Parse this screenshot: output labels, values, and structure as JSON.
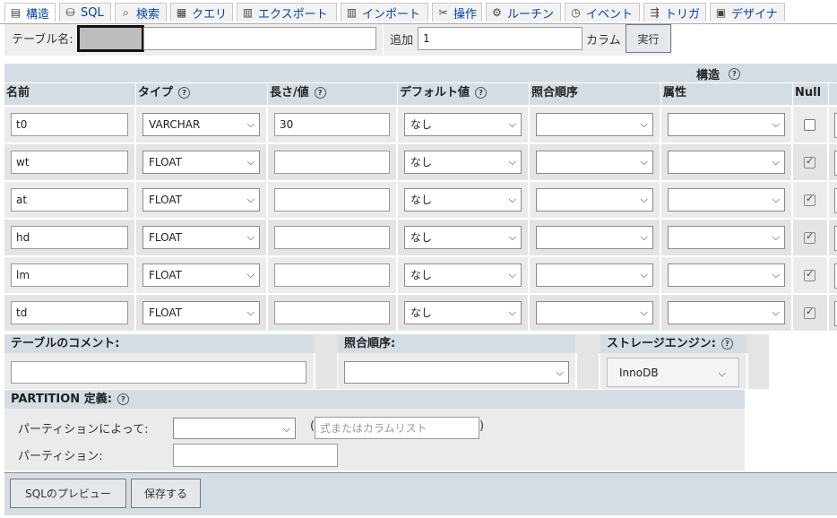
{
  "tabs": [
    {
      "label": "構造",
      "icon": "structure-icon",
      "glyph": "▤"
    },
    {
      "label": "SQL",
      "icon": "sql-icon",
      "glyph": "⛁"
    },
    {
      "label": "検索",
      "icon": "search-icon",
      "glyph": "⌕"
    },
    {
      "label": "クエリ",
      "icon": "query-icon",
      "glyph": "▦"
    },
    {
      "label": "エクスポート",
      "icon": "export-icon",
      "glyph": "▥"
    },
    {
      "label": "インポート",
      "icon": "import-icon",
      "glyph": "▥"
    },
    {
      "label": "操作",
      "icon": "operations-icon",
      "glyph": "✂"
    },
    {
      "label": "ルーチン",
      "icon": "routines-icon",
      "glyph": "⚙"
    },
    {
      "label": "イベント",
      "icon": "events-icon",
      "glyph": "◷"
    },
    {
      "label": "トリガ",
      "icon": "triggers-icon",
      "glyph": "⇶"
    },
    {
      "label": "デザイナ",
      "icon": "designer-icon",
      "glyph": "▣"
    }
  ],
  "table_name": {
    "label": "テーブル名:",
    "value": ""
  },
  "add": {
    "label": "追加",
    "value": "1",
    "unit": "カラム",
    "go": "実行"
  },
  "structure": {
    "title": "構造",
    "headers": {
      "name": "名前",
      "type": "タイプ",
      "length": "長さ/値",
      "default": "デフォルト値",
      "collation": "照合順序",
      "attributes": "属性",
      "null": "Null"
    },
    "rows": [
      {
        "name": "t0",
        "type": "VARCHAR",
        "length": "30",
        "default": "なし",
        "collation": "",
        "attributes": "",
        "null": false
      },
      {
        "name": "wt",
        "type": "FLOAT",
        "length": "",
        "default": "なし",
        "collation": "",
        "attributes": "",
        "null": true
      },
      {
        "name": "at",
        "type": "FLOAT",
        "length": "",
        "default": "なし",
        "collation": "",
        "attributes": "",
        "null": true
      },
      {
        "name": "hd",
        "type": "FLOAT",
        "length": "",
        "default": "なし",
        "collation": "",
        "attributes": "",
        "null": true
      },
      {
        "name": "lm",
        "type": "FLOAT",
        "length": "",
        "default": "なし",
        "collation": "",
        "attributes": "",
        "null": true
      },
      {
        "name": "td",
        "type": "FLOAT",
        "length": "",
        "default": "なし",
        "collation": "",
        "attributes": "",
        "null": true
      }
    ]
  },
  "table_comment": {
    "label": "テーブルのコメント:",
    "value": ""
  },
  "table_collation": {
    "label": "照合順序:",
    "value": ""
  },
  "storage_engine": {
    "label": "ストレージエンジン:",
    "value": "InnoDB"
  },
  "partition": {
    "title": "PARTITION 定義:",
    "by_label": "パーティションによって:",
    "by_value": "",
    "expr_placeholder": "式またはカラムリスト",
    "partitions_label": "パーティション:",
    "partitions_value": ""
  },
  "footer": {
    "preview": "SQLのプレビュー",
    "save": "保存する"
  }
}
